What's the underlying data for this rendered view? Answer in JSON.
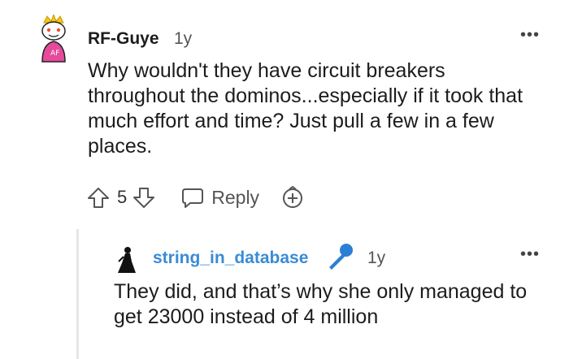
{
  "comment": {
    "username": "RF-Guye",
    "age": "1y",
    "more": "•••",
    "text": "Why wouldn't they have circuit breakers throughout the dominos...especially if it took that much effort and time? Just pull a few in a few places.",
    "score": "5",
    "reply_label": "Reply"
  },
  "reply": {
    "username": "string_in_database",
    "age": "1y",
    "more": "•••",
    "text": "They did, and that’s why she only managed to get 23000 instead of 4 million"
  },
  "colors": {
    "username_link": "#3a8bd6",
    "mic_icon": "#2a7fd4",
    "avatar_accent": "#e64a9a"
  },
  "icons": [
    "avatar-snoo-icon",
    "upvote-icon",
    "downvote-icon",
    "comment-bubble-icon",
    "award-icon",
    "microphone-icon",
    "avatar-figure-icon",
    "more-options-icon"
  ]
}
